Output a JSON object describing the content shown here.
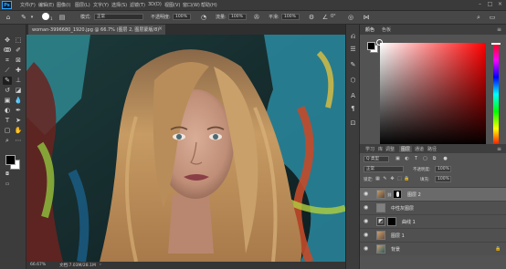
{
  "app": {
    "logo": "Ps",
    "menu": [
      "文件(F)",
      "编辑(E)",
      "图像(I)",
      "图层(L)",
      "文字(Y)",
      "选择(S)",
      "滤镜(T)",
      "3D(D)",
      "视图(V)",
      "窗口(W)",
      "帮助(H)"
    ],
    "window_controls": [
      "–",
      "□",
      "×"
    ]
  },
  "options_bar": {
    "brush_size": "1",
    "mode_label": "模式:",
    "mode_value": "正常",
    "opacity_label": "不透明度:",
    "opacity_value": "100%",
    "flow_label": "流量:",
    "flow_value": "100%",
    "smoothing_label": "平滑:",
    "smoothing_value": "100%",
    "angle_value": "0°"
  },
  "document": {
    "tab_title": "woman-3996680_1920.jpg @ 66.7% (图层 2, 图层蒙版/8)",
    "close": "×"
  },
  "status": {
    "zoom": "66.67%",
    "doc_size": "文档:7.03M/28.1M"
  },
  "color_panel": {
    "tabs": [
      "颜色",
      "色板"
    ],
    "foreground": "#000000",
    "background": "#ffffff",
    "hue": "#ff0000"
  },
  "layers_panel": {
    "tabs": [
      "学习",
      "库",
      "调整",
      "图层",
      "通道",
      "路径"
    ],
    "active_tab": "图层",
    "filter_label": "Q 类型",
    "blend_mode": "正常",
    "opacity_label": "不透明度:",
    "opacity_value": "100%",
    "lock_label": "锁定:",
    "fill_label": "填充:",
    "fill_value": "100%",
    "layers": [
      {
        "name": "图层 2",
        "selected": true
      },
      {
        "name": "中性灰图层",
        "selected": false
      },
      {
        "name": "曲线 1",
        "selected": false
      },
      {
        "name": "图层 1",
        "selected": false
      },
      {
        "name": "背景",
        "selected": false
      }
    ]
  },
  "toolbar": {
    "tools": [
      "move",
      "marquee",
      "lasso",
      "quick-select",
      "crop",
      "frame",
      "eyedropper",
      "healing",
      "brush",
      "stamp",
      "history-brush",
      "eraser",
      "gradient",
      "blur",
      "dodge",
      "pen",
      "text",
      "path-select",
      "rectangle",
      "hand",
      "zoom",
      "more"
    ],
    "fg_color": "#000000",
    "bg_color": "#ffffff"
  }
}
